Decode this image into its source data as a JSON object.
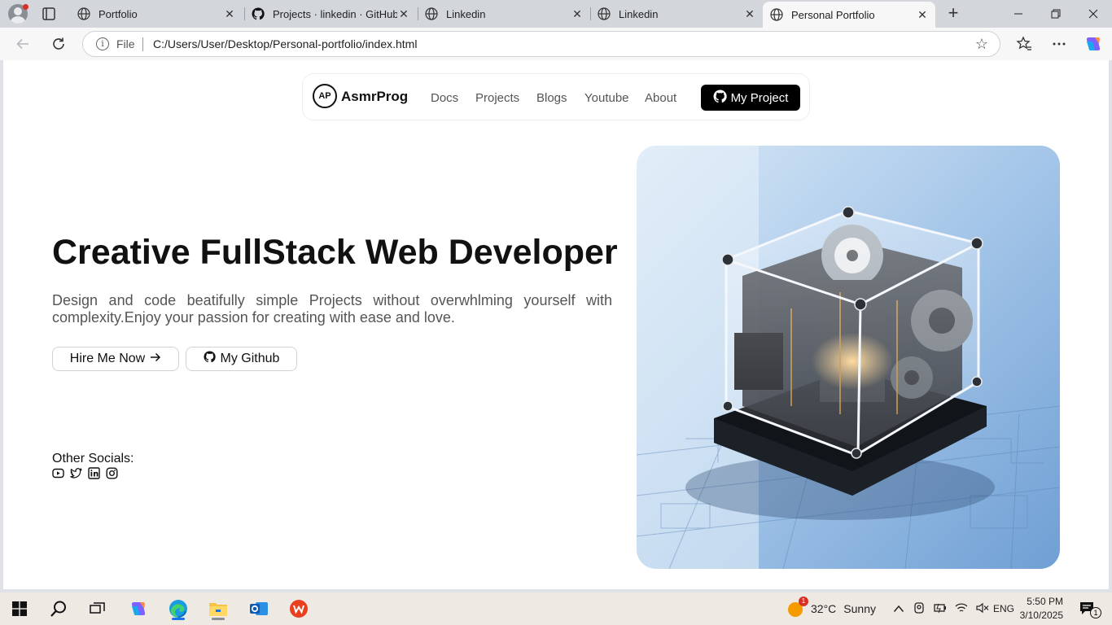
{
  "browser": {
    "tabs": [
      {
        "title": "Portfolio",
        "icon": "globe-icon"
      },
      {
        "title": "Projects · linkedin · GitHub",
        "icon": "github-icon"
      },
      {
        "title": "Linkedin",
        "icon": "globe-icon"
      },
      {
        "title": "Linkedin",
        "icon": "globe-icon"
      },
      {
        "title": "Personal Portfolio",
        "icon": "globe-icon",
        "active": true
      }
    ],
    "address": {
      "scheme_label": "File",
      "url": "C:/Users/User/Desktop/Personal-portfolio/index.html"
    }
  },
  "site": {
    "brand": {
      "logo_text": "AP",
      "name": "AsmrProg"
    },
    "nav": [
      "Docs",
      "Projects",
      "Blogs",
      "Youtube",
      "About"
    ],
    "cta": "My Project",
    "hero": {
      "title": "Creative FullStack Web Developer",
      "description": "Design and code beatifully simple Projects without overwhlming yourself with complexity.Enjoy your passion for creating with ease and love.",
      "primary_button": "Hire Me Now",
      "secondary_button": "My Github"
    },
    "socials_label": "Other Socials:",
    "socials": [
      "youtube-icon",
      "twitter-icon",
      "linkedin-icon",
      "instagram-icon"
    ]
  },
  "taskbar": {
    "weather": {
      "temp": "32°C",
      "condition": "Sunny",
      "badge": "1"
    },
    "language": "ENG",
    "time": "5:50 PM",
    "date": "3/10/2025",
    "notifications": "1"
  },
  "colors": {
    "accent": "#000000",
    "edge": "#1a73e8",
    "taskbar": "#efe9e4"
  }
}
